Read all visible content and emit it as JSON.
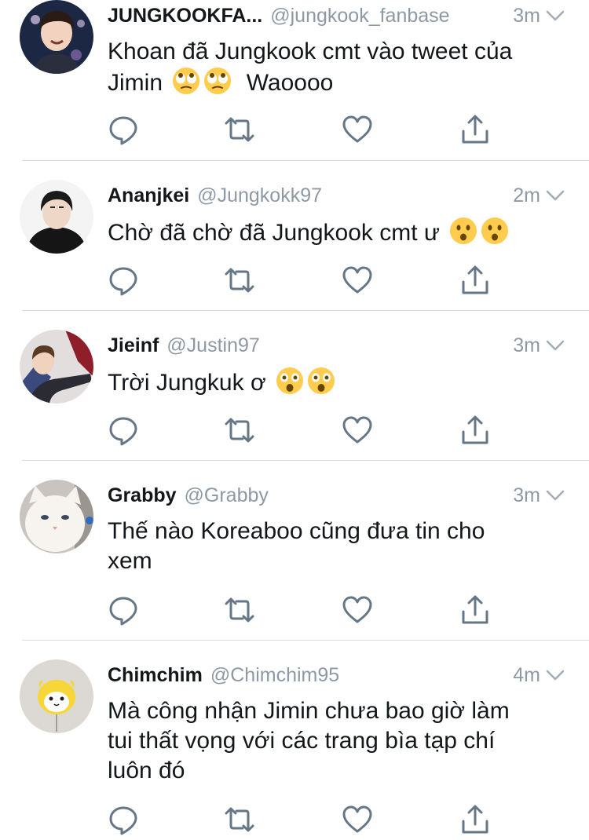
{
  "colors": {
    "name": "#14171a",
    "muted": "#8e99a3",
    "icon": "#657786",
    "divider": "#d8dde1"
  },
  "tweets": [
    {
      "name": "JUNGKOOKFA...",
      "handle": "@jungkook_fanbase",
      "time": "3m",
      "avatar_icon": "jungkook-avatar",
      "lines": [
        "Khoan đã Jungkook cmt vào tweet của",
        "Jimin"
      ],
      "emoji": [
        "eye-roll-emoji",
        "eye-roll-emoji"
      ],
      "after_emoji": "Waoooo"
    },
    {
      "name": "Ananjkei",
      "handle": "@Jungkokk97",
      "time": "2m",
      "avatar_icon": "hoodie-boy-avatar",
      "lines": [
        "Chờ đã chờ đã Jungkook cmt ư"
      ],
      "emoji": [
        "hushed-face-emoji",
        "hushed-face-emoji"
      ]
    },
    {
      "name": "Jieinf",
      "handle": "@Justin97",
      "time": "3m",
      "avatar_icon": "pointing-boy-avatar",
      "lines": [
        "Trời Jungkuk ơ"
      ],
      "emoji": [
        "astonished-face-emoji",
        "astonished-face-emoji"
      ]
    },
    {
      "name": "Grabby",
      "handle": "@Grabby",
      "time": "3m",
      "avatar_icon": "white-cat-avatar",
      "lines": [
        "Thế nào Koreaboo cũng đưa tin cho",
        "xem"
      ]
    },
    {
      "name": "Chimchim",
      "handle": "@Chimchim95",
      "time": "4m",
      "avatar_icon": "chimmy-plush-avatar",
      "lines": [
        "Mà công nhận Jimin chưa bao giờ làm",
        "tui thất vọng với các trang bìa tạp chí",
        "luôn đó"
      ]
    }
  ]
}
